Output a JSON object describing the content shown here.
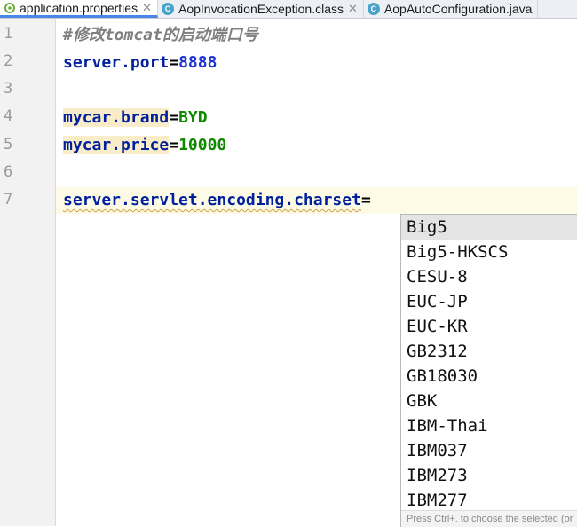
{
  "tabs": [
    {
      "label": "application.properties",
      "icon": "properties-file-icon",
      "active": true
    },
    {
      "label": "AopInvocationException.class",
      "icon": "class-file-icon",
      "active": false
    },
    {
      "label": "AopAutoConfiguration.java",
      "icon": "class-file-icon",
      "active": false
    }
  ],
  "close_glyph": "✕",
  "class_icon_letter": "C",
  "gutter": {
    "line_numbers": [
      "1",
      "2",
      "3",
      "4",
      "5",
      "6",
      "7"
    ]
  },
  "editor": {
    "line1": {
      "comment": "#修改tomcat的启动端口号"
    },
    "line2": {
      "key": "server.port",
      "eq": "=",
      "value": "8888"
    },
    "line4": {
      "key": "mycar.brand",
      "eq": "=",
      "value": "BYD"
    },
    "line5": {
      "key": "mycar.price",
      "eq": "=",
      "value": "10000"
    },
    "line7": {
      "key": "server.servlet.encoding.charset",
      "eq": "="
    }
  },
  "completion": {
    "items": [
      "Big5",
      "Big5-HKSCS",
      "CESU-8",
      "EUC-JP",
      "EUC-KR",
      "GB2312",
      "GB18030",
      "GBK",
      "IBM-Thai",
      "IBM037",
      "IBM273",
      "IBM277"
    ],
    "selected_index": 0,
    "footer_hint": "Press Ctrl+. to choose the selected (or"
  },
  "colors": {
    "key": "#00209e",
    "value_text": "#0f8a00",
    "value_number": "#1d35d8",
    "comment": "#808080",
    "key_highlight": "#f9ecc8",
    "selection": "#e4e4e4"
  }
}
